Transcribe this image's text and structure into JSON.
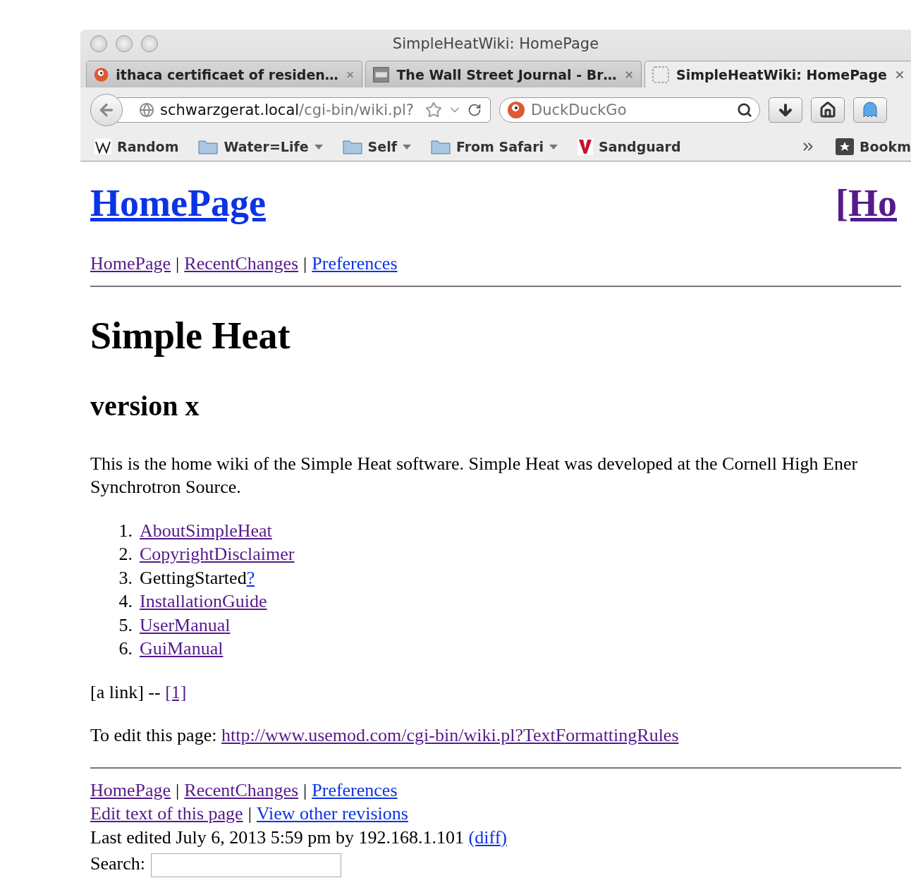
{
  "window": {
    "title": "SimpleHeatWiki: HomePage"
  },
  "tabs": [
    {
      "label": "ithaca certificaet of residen…",
      "kind": "duck",
      "selected": false
    },
    {
      "label": "The Wall Street Journal - Br…",
      "kind": "wsj",
      "selected": false
    },
    {
      "label": "SimpleHeatWiki: HomePage",
      "kind": "blank",
      "selected": true
    }
  ],
  "address_bar": {
    "host": "schwarzgerat.local",
    "path": "/cgi-bin/wiki.pl?"
  },
  "search": {
    "placeholder": "DuckDuckGo"
  },
  "bookmarks": [
    {
      "label": "Random",
      "kind": "wiki"
    },
    {
      "label": "Water=Life",
      "kind": "folder"
    },
    {
      "label": "Self",
      "kind": "folder"
    },
    {
      "label": "From Safari",
      "kind": "folder"
    },
    {
      "label": "Sandguard",
      "kind": "v"
    }
  ],
  "bookmarks_menu": {
    "label": "Bookm"
  },
  "page": {
    "title": {
      "text": "HomePage",
      "visited": false
    },
    "header_right": {
      "text": "[Ho",
      "visited": true
    },
    "nav": {
      "separator": "|",
      "links": [
        {
          "text": "HomePage",
          "visited": true
        },
        {
          "text": "RecentChanges",
          "visited": true
        },
        {
          "text": "Preferences",
          "visited": false
        }
      ]
    },
    "heading": "Simple Heat",
    "subheading": "version x",
    "intro": [
      "This is the home wiki of the Simple Heat software. Simple Heat was developed at the Cornell High Ener",
      "Synchrotron Source."
    ],
    "list": [
      {
        "number": "1.",
        "kind": "link",
        "text": "AboutSimpleHeat",
        "visited": true
      },
      {
        "number": "2.",
        "kind": "link",
        "text": "CopyrightDisclaimer",
        "visited": true
      },
      {
        "number": "3.",
        "kind": "missing",
        "text": "GettingStarted",
        "link": "?",
        "visited": false
      },
      {
        "number": "4.",
        "kind": "link",
        "text": "InstallationGuide",
        "visited": true
      },
      {
        "number": "5.",
        "kind": "link",
        "text": "UserManual",
        "visited": true
      },
      {
        "number": "6.",
        "kind": "link",
        "text": "GuiManual",
        "visited": true
      }
    ],
    "a_link": {
      "text": "[a link] --",
      "link": {
        "text": "[1]",
        "visited": true
      }
    },
    "edit_note": {
      "text": "To edit this page:",
      "link": {
        "text": "http://www.usemod.com/cgi-bin/wiki.pl?TextFormattingRules",
        "visited": true
      }
    },
    "footer_nav": {
      "separator": "|",
      "links": [
        {
          "text": "HomePage",
          "visited": true
        },
        {
          "text": "RecentChanges",
          "visited": true
        },
        {
          "text": "Preferences",
          "visited": false
        }
      ]
    },
    "footer_actions": {
      "separator": "|",
      "links": [
        {
          "text": "Edit text of this page",
          "visited": true
        },
        {
          "text": "View other revisions",
          "visited": false
        }
      ]
    },
    "last_edited": {
      "text": "Last edited July 6, 2013 5:59 pm by 192.168.1.101",
      "link": {
        "text": "(diff)",
        "visited": false
      }
    },
    "search": {
      "label": "Search:"
    }
  }
}
